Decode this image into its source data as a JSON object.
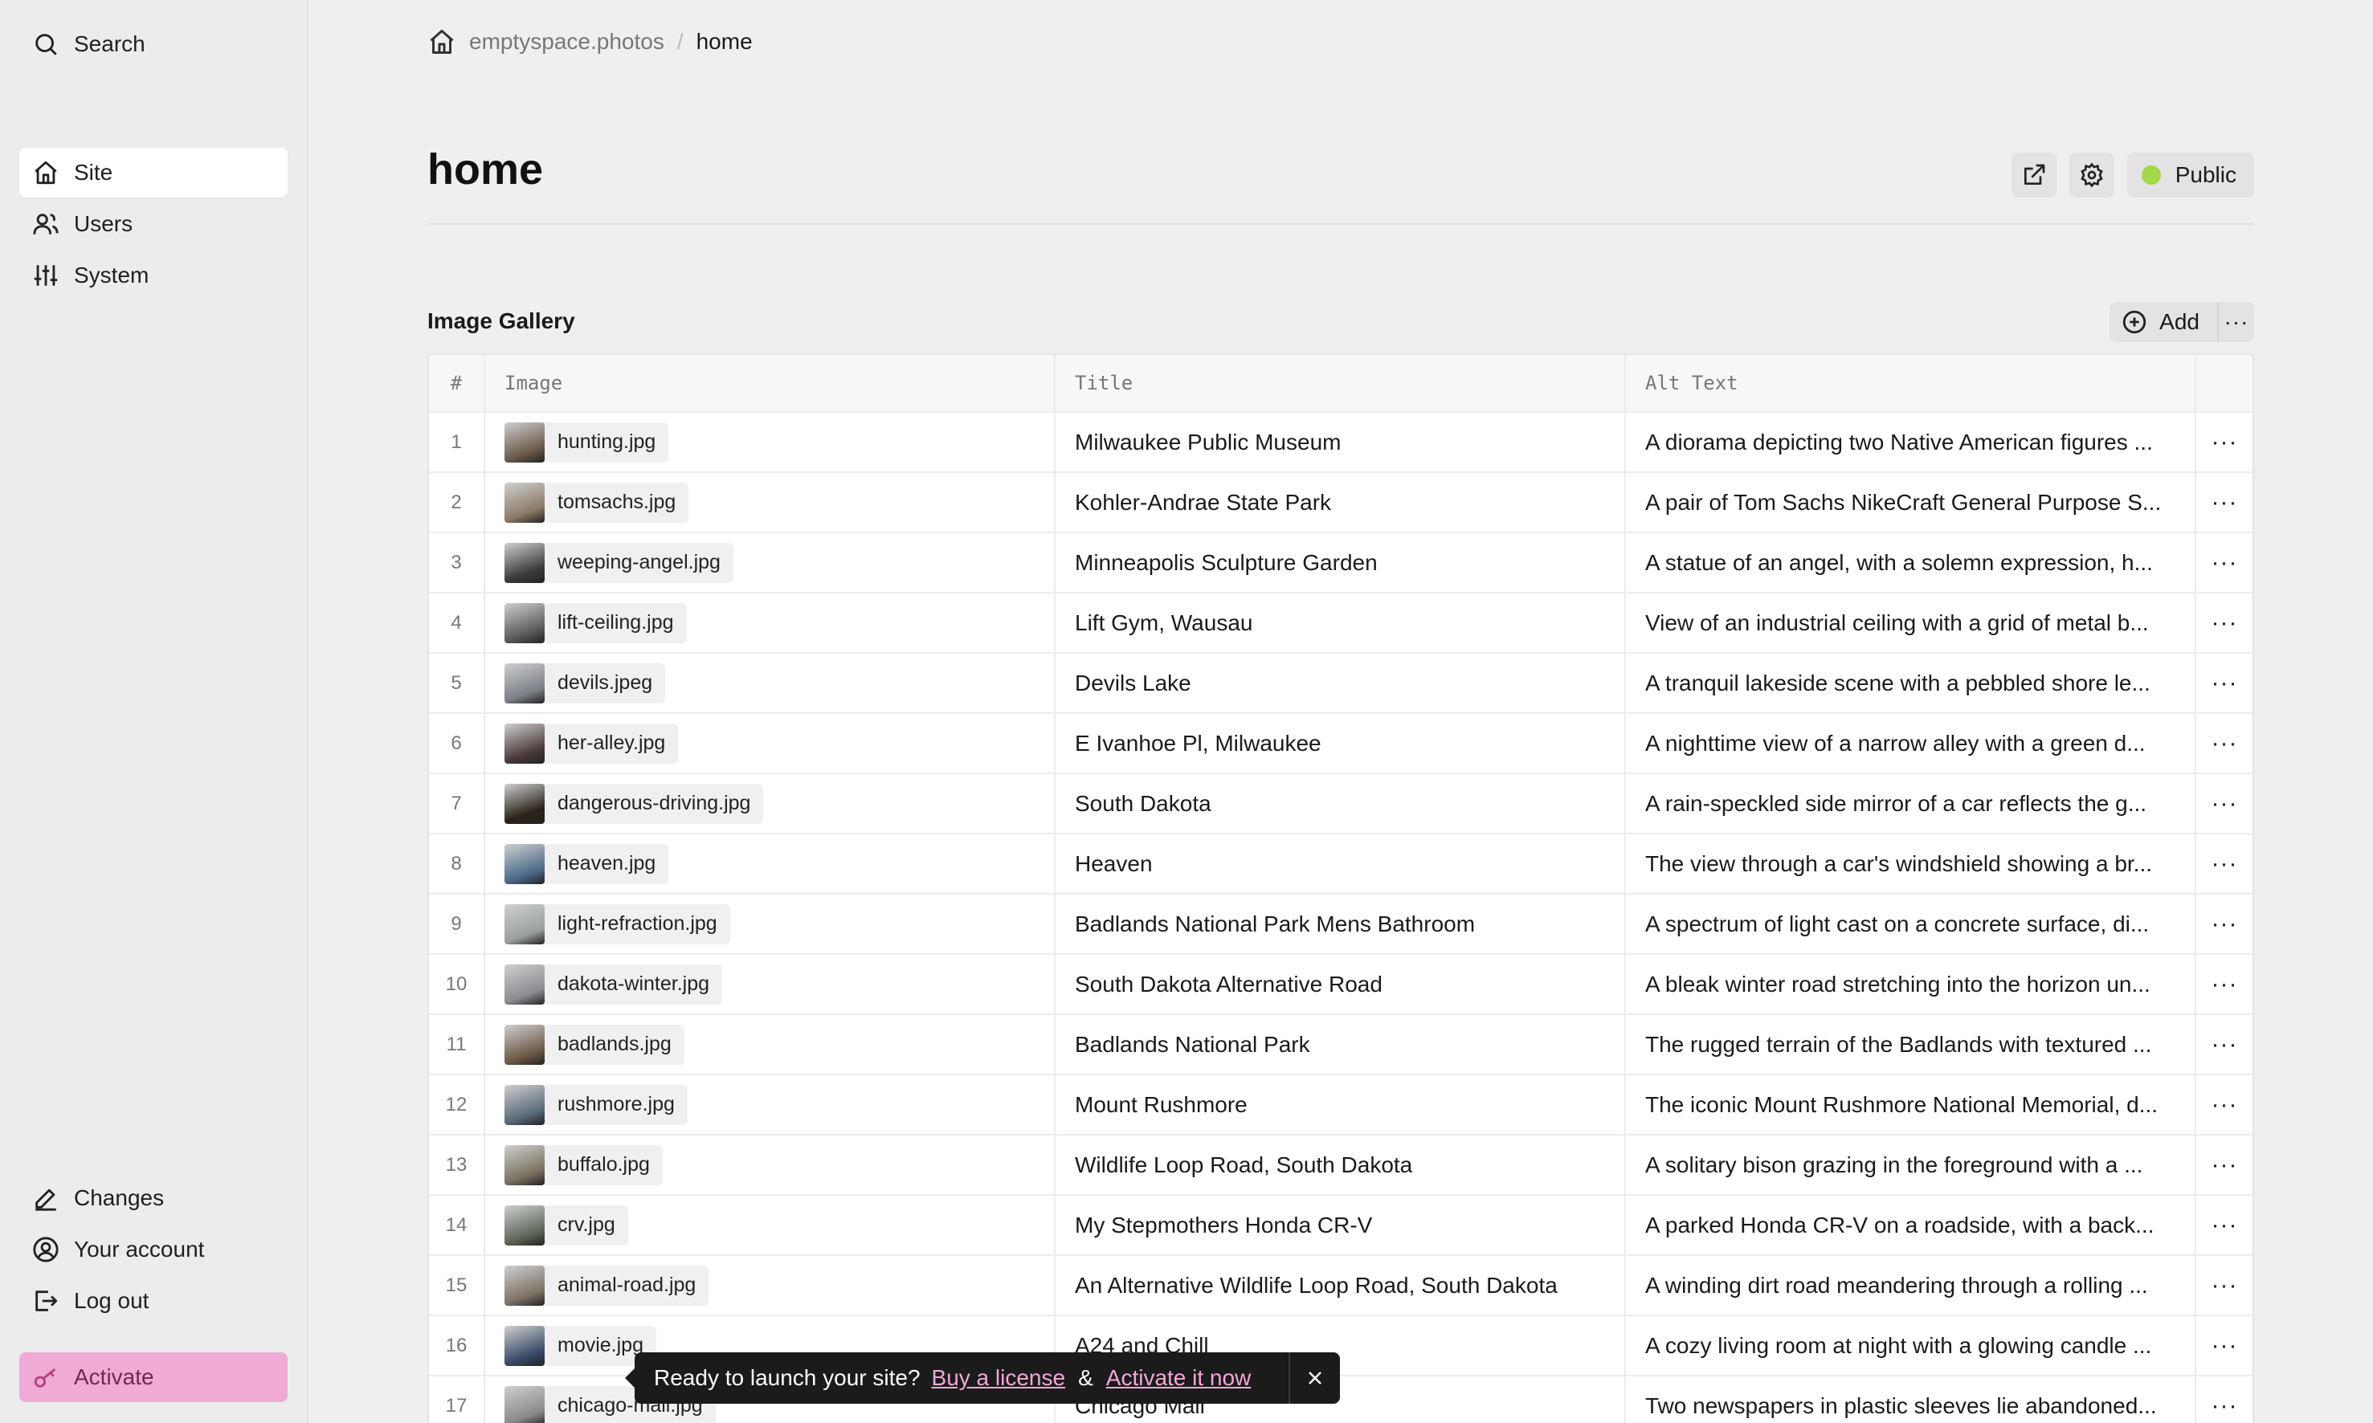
{
  "sidebar": {
    "search_label": "Search",
    "nav": [
      {
        "label": "Site",
        "icon": "home-icon",
        "active": true
      },
      {
        "label": "Users",
        "icon": "users-icon"
      },
      {
        "label": "System",
        "icon": "sliders-icon"
      }
    ],
    "bottom": [
      {
        "label": "Changes",
        "icon": "pencil-icon"
      },
      {
        "label": "Your account",
        "icon": "account-icon"
      },
      {
        "label": "Log out",
        "icon": "logout-icon"
      }
    ],
    "activate_label": "Activate"
  },
  "breadcrumb": {
    "site": "emptyspace.photos",
    "separator": "/",
    "current": "home"
  },
  "page": {
    "title": "home",
    "status_label": "Public",
    "status_color": "#a4d84c"
  },
  "gallery": {
    "label": "Image Gallery",
    "add_label": "Add",
    "more_label": "···",
    "columns": {
      "num": "#",
      "image": "Image",
      "title": "Title",
      "alt": "Alt Text"
    },
    "rows": [
      {
        "num": "1",
        "file": "hunting.jpg",
        "title": "Milwaukee Public Museum",
        "alt": "A diorama depicting two Native American figures ..."
      },
      {
        "num": "2",
        "file": "tomsachs.jpg",
        "title": "Kohler-Andrae State Park",
        "alt": "A pair of Tom Sachs NikeCraft General Purpose S..."
      },
      {
        "num": "3",
        "file": "weeping-angel.jpg",
        "title": "Minneapolis Sculpture Garden",
        "alt": "A statue of an angel, with a solemn expression, h..."
      },
      {
        "num": "4",
        "file": "lift-ceiling.jpg",
        "title": "Lift Gym, Wausau",
        "alt": "View of an industrial ceiling with a grid of metal b..."
      },
      {
        "num": "5",
        "file": "devils.jpeg",
        "title": "Devils Lake",
        "alt": "A tranquil lakeside scene with a pebbled shore le..."
      },
      {
        "num": "6",
        "file": "her-alley.jpg",
        "title": "E Ivanhoe Pl, Milwaukee",
        "alt": "A nighttime view of a narrow alley with a green d..."
      },
      {
        "num": "7",
        "file": "dangerous-driving.jpg",
        "title": "South Dakota",
        "alt": "A rain-speckled side mirror of a car reflects the g..."
      },
      {
        "num": "8",
        "file": "heaven.jpg",
        "title": "Heaven",
        "alt": "The view through a car's windshield showing a br..."
      },
      {
        "num": "9",
        "file": "light-refraction.jpg",
        "title": "Badlands National Park Mens Bathroom",
        "alt": "A spectrum of light cast on a concrete surface, di..."
      },
      {
        "num": "10",
        "file": "dakota-winter.jpg",
        "title": "South Dakota Alternative Road",
        "alt": "A bleak winter road stretching into the horizon un..."
      },
      {
        "num": "11",
        "file": "badlands.jpg",
        "title": "Badlands National Park",
        "alt": "The rugged terrain of the Badlands with textured ..."
      },
      {
        "num": "12",
        "file": "rushmore.jpg",
        "title": "Mount Rushmore",
        "alt": "The iconic Mount Rushmore National Memorial, d..."
      },
      {
        "num": "13",
        "file": "buffalo.jpg",
        "title": "Wildlife Loop Road, South Dakota",
        "alt": "A solitary bison grazing in the foreground with a ..."
      },
      {
        "num": "14",
        "file": "crv.jpg",
        "title": "My Stepmothers Honda CR-V",
        "alt": "A parked Honda CR-V on a roadside, with a back..."
      },
      {
        "num": "15",
        "file": "animal-road.jpg",
        "title": "An Alternative Wildlife Loop Road, South Dakota",
        "alt": "A winding dirt road meandering through a rolling ..."
      },
      {
        "num": "16",
        "file": "movie.jpg",
        "title": "A24 and Chill",
        "alt": "A cozy living room at night with a glowing candle ..."
      },
      {
        "num": "17",
        "file": "chicago-mail.jpg",
        "title": "Chicago Mail",
        "alt": "Two newspapers in plastic sleeves lie abandoned..."
      }
    ]
  },
  "toast": {
    "message": "Ready to launch your site?",
    "buy_label": "Buy a license",
    "amp": "&",
    "activate_label": "Activate it now"
  }
}
